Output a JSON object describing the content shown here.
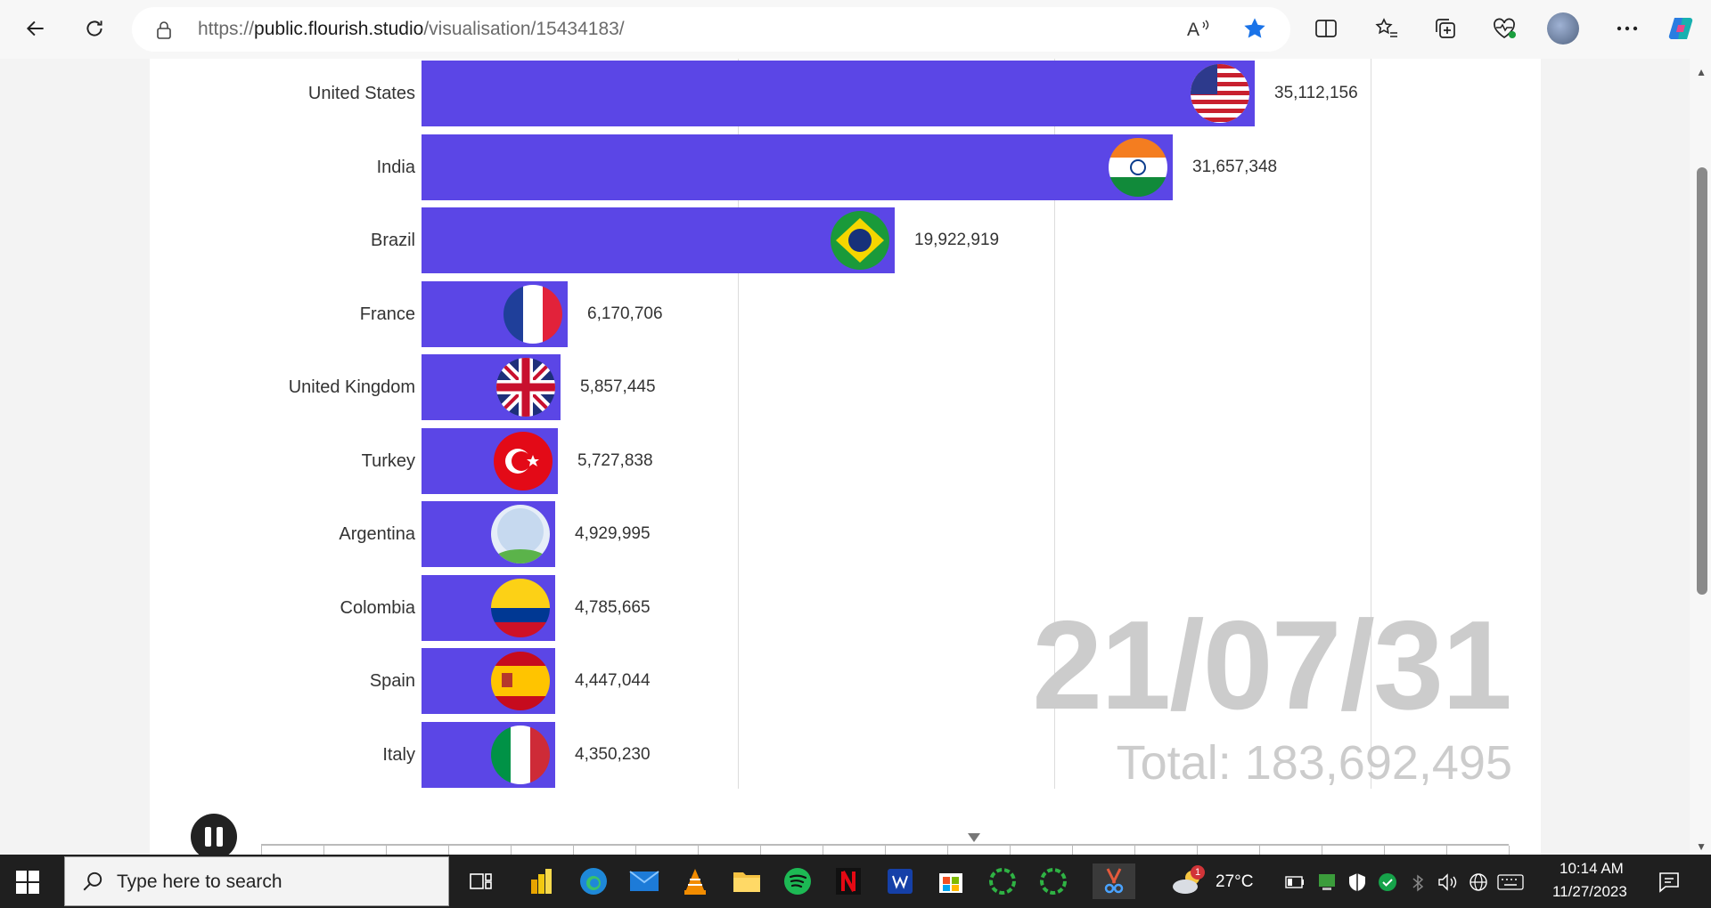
{
  "browser": {
    "url_scheme": "https://",
    "url_host": "public.flourish.studio",
    "url_path": "/visualisation/15434183/"
  },
  "chart_data": {
    "type": "bar",
    "categories": [
      "United States",
      "India",
      "Brazil",
      "France",
      "United Kingdom",
      "Turkey",
      "Argentina",
      "Colombia",
      "Spain",
      "Italy"
    ],
    "values": [
      35112156,
      31657348,
      19922919,
      6170706,
      5857445,
      5727838,
      4929995,
      4785665,
      4447044,
      4350230
    ],
    "value_labels": [
      "35,112,156",
      "31,657,348",
      "19,922,919",
      "6,170,706",
      "5,857,445",
      "5,727,838",
      "4,929,995",
      "4,785,665",
      "4,447,044",
      "4,350,230"
    ],
    "date": "21/07/31",
    "total_label": "Total: 183,692,495",
    "bar_color": "#5b46e6"
  },
  "controls": {
    "play_state": "pause-icon"
  },
  "taskbar": {
    "search_placeholder": "Type here to search",
    "weather": "27°C",
    "weather_badge": "1",
    "time": "10:14 AM",
    "date": "11/27/2023"
  }
}
